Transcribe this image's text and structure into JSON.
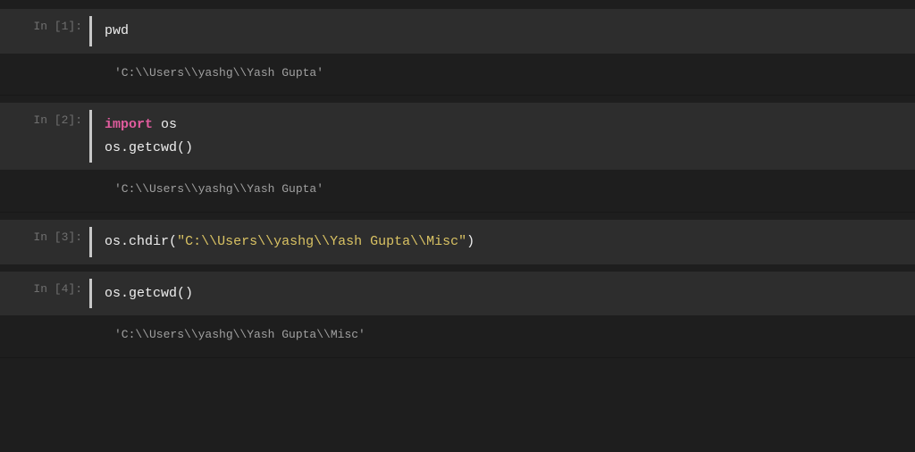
{
  "cells": [
    {
      "prompt": "In [1]:",
      "code": [
        [
          {
            "cls": "c-id",
            "t": "pwd"
          }
        ]
      ],
      "output": "'C:\\\\Users\\\\yashg\\\\Yash Gupta'"
    },
    {
      "prompt": "In [2]:",
      "code": [
        [
          {
            "cls": "c-kw",
            "t": "import"
          },
          {
            "cls": "c-id",
            "t": " os"
          }
        ],
        [
          {
            "cls": "c-id",
            "t": "os"
          },
          {
            "cls": "c-punct",
            "t": "."
          },
          {
            "cls": "c-fn",
            "t": "getcwd"
          },
          {
            "cls": "c-punct",
            "t": "()"
          }
        ]
      ],
      "output": "'C:\\\\Users\\\\yashg\\\\Yash Gupta'"
    },
    {
      "prompt": "In [3]:",
      "code": [
        [
          {
            "cls": "c-id",
            "t": "os"
          },
          {
            "cls": "c-punct",
            "t": "."
          },
          {
            "cls": "c-fn",
            "t": "chdir"
          },
          {
            "cls": "c-punct",
            "t": "("
          },
          {
            "cls": "c-str",
            "t": "\"C:\\\\Users\\\\yashg\\\\Yash Gupta\\\\Misc\""
          },
          {
            "cls": "c-punct",
            "t": ")"
          }
        ]
      ],
      "output": null
    },
    {
      "prompt": "In [4]:",
      "code": [
        [
          {
            "cls": "c-id",
            "t": "os"
          },
          {
            "cls": "c-punct",
            "t": "."
          },
          {
            "cls": "c-fn",
            "t": "getcwd"
          },
          {
            "cls": "c-punct",
            "t": "()"
          }
        ]
      ],
      "output": "'C:\\\\Users\\\\yashg\\\\Yash Gupta\\\\Misc'"
    }
  ]
}
